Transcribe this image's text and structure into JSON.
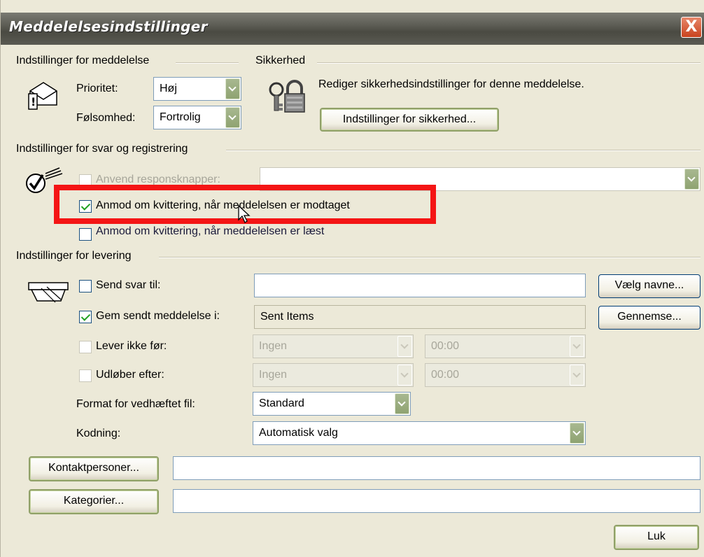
{
  "window": {
    "title": "Meddelelsesindstillinger",
    "close_glyph": "X"
  },
  "message_settings": {
    "group_label": "Indstillinger for meddelelse",
    "priority_label": "Prioritet:",
    "priority_value": "Høj",
    "sensitivity_label": "Følsomhed:",
    "sensitivity_value": "Fortrolig"
  },
  "security": {
    "group_label": "Sikkerhed",
    "description": "Rediger sikkerhedsindstillinger for denne meddelelse.",
    "button_label": "Indstillinger for sikkerhed..."
  },
  "voting_tracking": {
    "group_label": "Indstillinger for svar og registrering",
    "voting_buttons_label": "Anvend responsknapper:",
    "voting_buttons_value": "",
    "delivery_receipt_label": "Anmod om kvittering, når meddelelsen er modtaget",
    "delivery_receipt_checked": true,
    "read_receipt_label": "Anmod om kvittering, når meddelelsen er læst",
    "read_receipt_checked": false
  },
  "delivery": {
    "group_label": "Indstillinger for levering",
    "send_replies_label": "Send svar til:",
    "send_replies_value": "",
    "select_names_button": "Vælg navne...",
    "save_sent_label": "Gem sendt meddelelse i:",
    "save_sent_value": "Sent Items",
    "browse_button": "Gennemse...",
    "no_deliver_before_label": "Lever ikke før:",
    "no_deliver_before_date": "Ingen",
    "no_deliver_before_time": "00:00",
    "expires_after_label": "Udløber efter:",
    "expires_after_date": "Ingen",
    "expires_after_time": "00:00",
    "attachment_format_label": "Format for vedhæftet fil:",
    "attachment_format_value": "Standard",
    "encoding_label": "Kodning:",
    "encoding_value": "Automatisk valg"
  },
  "contacts": {
    "button_label": "Kontaktpersoner...",
    "value": ""
  },
  "categories": {
    "button_label": "Kategorier...",
    "value": ""
  },
  "footer": {
    "close_button_label": "Luk"
  },
  "colors": {
    "highlight": "#f41515",
    "dialog_bg": "#ece9d8",
    "title_bg": "#5c5c54"
  }
}
